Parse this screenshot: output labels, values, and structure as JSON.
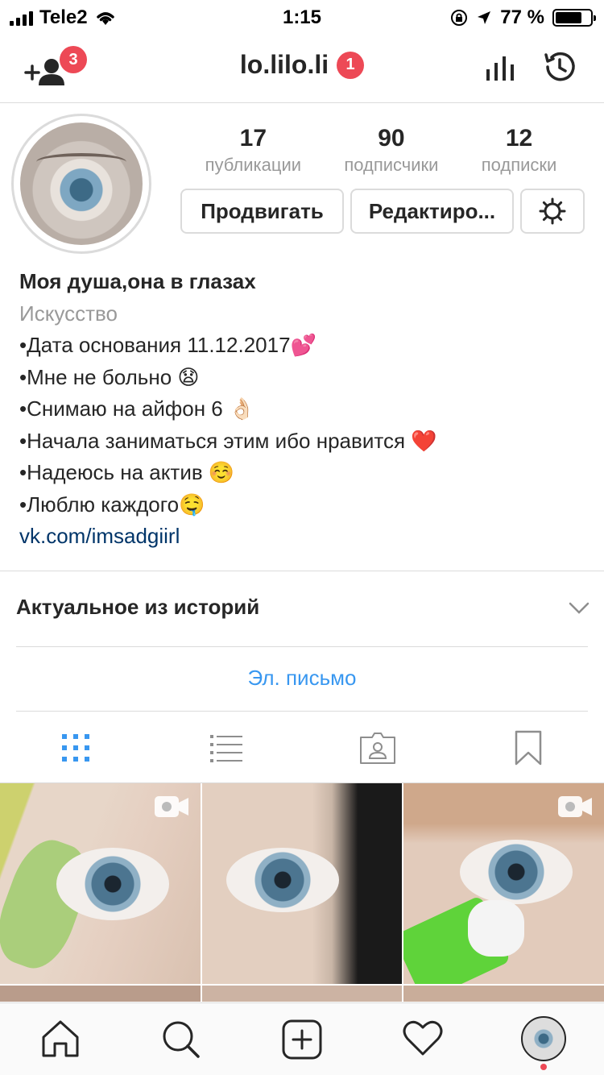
{
  "status": {
    "carrier": "Tele2",
    "time": "1:15",
    "battery": "77 %",
    "battery_level": 0.77
  },
  "header": {
    "username": "lo.lilo.li",
    "notifications_badge": "1",
    "follow_requests_badge": "3"
  },
  "profile": {
    "counts": [
      {
        "num": "17",
        "label": "публикации"
      },
      {
        "num": "90",
        "label": "подписчики"
      },
      {
        "num": "12",
        "label": "подписки"
      }
    ],
    "promote_label": "Продвигать",
    "edit_label": "Редактиро...",
    "bio": {
      "name": "Моя душа,она в глазах",
      "category": "Искусство",
      "lines": [
        "•Дата основания 11.12.2017💕",
        "•Мне не больно 😧",
        "•Снимаю на айфон 6 👌🏻",
        "•Начала заниматься этим ибо нравится ❤️",
        "•Надеюсь на актив ☺️",
        "•Люблю каждого🤤"
      ],
      "link": "vk.com/imsadgiirl"
    }
  },
  "highlights_label": "Актуальное из историй",
  "email_label": "Эл. письмо",
  "tabs": [
    "grid-icon",
    "list-icon",
    "tagged-icon",
    "saved-icon"
  ],
  "colors": {
    "accent": "#3897f0",
    "badge": "#ed4956",
    "link": "#003569"
  }
}
